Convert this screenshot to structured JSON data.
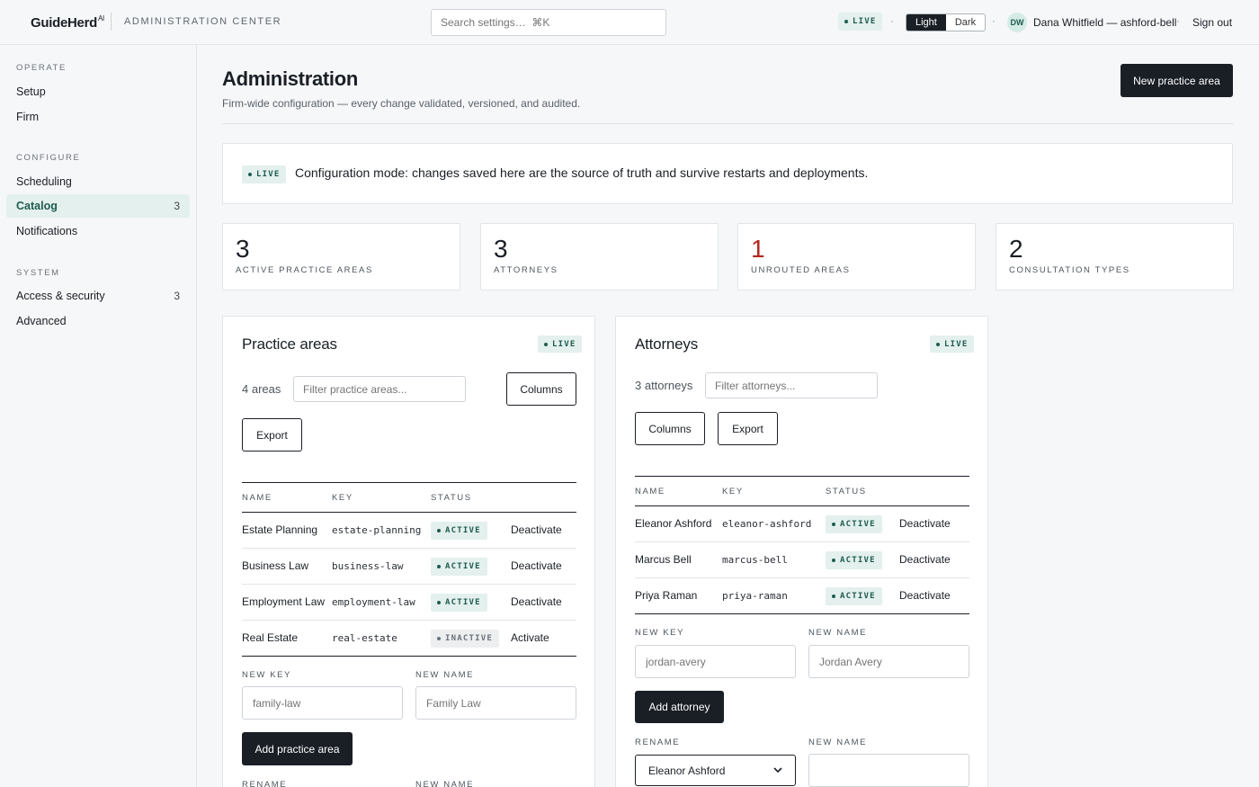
{
  "app": {
    "brand": "GuideHerd",
    "brand_sup": "AI",
    "section": "ADMINISTRATION CENTER",
    "search_placeholder": "Search settings…  ⌘K",
    "live": "LIVE",
    "theme_light": "Light",
    "theme_dark": "Dark",
    "avatar_initials": "DW",
    "user": "Dana Whitfield — ashford-bell",
    "sign_out": "Sign out",
    "separator": "·"
  },
  "sidebar": {
    "sections": [
      {
        "label": "OPERATE",
        "items": [
          {
            "label": "Setup"
          },
          {
            "label": "Firm"
          }
        ]
      },
      {
        "label": "CONFIGURE",
        "items": [
          {
            "label": "Scheduling"
          },
          {
            "label": "Catalog",
            "count": "3",
            "active": true
          },
          {
            "label": "Notifications"
          }
        ]
      },
      {
        "label": "SYSTEM",
        "items": [
          {
            "label": "Access & security",
            "count": "3"
          },
          {
            "label": "Advanced"
          }
        ]
      }
    ]
  },
  "main": {
    "title": "Administration",
    "subtitle": "Firm-wide configuration — every change validated, versioned, and audited.",
    "new_button": "New practice area",
    "banner": {
      "chip": "LIVE",
      "text": "Configuration mode: changes saved here are the source of truth and survive restarts and deployments."
    },
    "stats": [
      {
        "value": "3",
        "label": "ACTIVE PRACTICE AREAS",
        "color": "#1a1f26"
      },
      {
        "value": "3",
        "label": "ATTORNEYS",
        "color": "#1a1f26"
      },
      {
        "value": "1",
        "label": "UNROUTED AREAS",
        "color": "#b3261e"
      },
      {
        "value": "2",
        "label": "CONSULTATION TYPES",
        "color": "#1a1f26"
      }
    ]
  },
  "practice_areas": {
    "title": "Practice areas",
    "chip": "LIVE",
    "count": "4 areas",
    "filter_placeholder": "Filter practice areas...",
    "columns_button": "Columns",
    "export_button": "Export",
    "headers": {
      "name": "NAME",
      "key": "KEY",
      "status": "STATUS"
    },
    "rows": [
      {
        "name": "Estate Planning",
        "key": "estate-planning",
        "status": "ACTIVE",
        "action": "Deactivate"
      },
      {
        "name": "Business Law",
        "key": "business-law",
        "status": "ACTIVE",
        "action": "Deactivate"
      },
      {
        "name": "Employment Law",
        "key": "employment-law",
        "status": "ACTIVE",
        "action": "Deactivate"
      },
      {
        "name": "Real Estate",
        "key": "real-estate",
        "status": "INACTIVE",
        "action": "Activate"
      }
    ],
    "new_key_label": "NEW KEY",
    "new_key_placeholder": "family-law",
    "new_name_label": "NEW NAME",
    "new_name_placeholder": "Family Law",
    "add_button": "Add practice area",
    "rename_label": "RENAME",
    "rename_new_name_label": "NEW NAME"
  },
  "attorneys": {
    "title": "Attorneys",
    "chip": "LIVE",
    "count": "3 attorneys",
    "filter_placeholder": "Filter attorneys...",
    "columns_button": "Columns",
    "export_button": "Export",
    "headers": {
      "name": "NAME",
      "key": "KEY",
      "status": "STATUS"
    },
    "rows": [
      {
        "name": "Eleanor Ashford",
        "key": "eleanor-ashford",
        "status": "ACTIVE",
        "action": "Deactivate"
      },
      {
        "name": "Marcus Bell",
        "key": "marcus-bell",
        "status": "ACTIVE",
        "action": "Deactivate"
      },
      {
        "name": "Priya Raman",
        "key": "priya-raman",
        "status": "ACTIVE",
        "action": "Deactivate"
      }
    ],
    "new_key_label": "NEW KEY",
    "new_key_placeholder": "jordan-avery",
    "new_name_label": "NEW NAME",
    "new_name_placeholder": "Jordan Avery",
    "add_button": "Add attorney",
    "rename_label": "RENAME",
    "rename_selected": "Eleanor Ashford",
    "rename_new_name_label": "NEW NAME",
    "rename_new_name_value": ""
  }
}
